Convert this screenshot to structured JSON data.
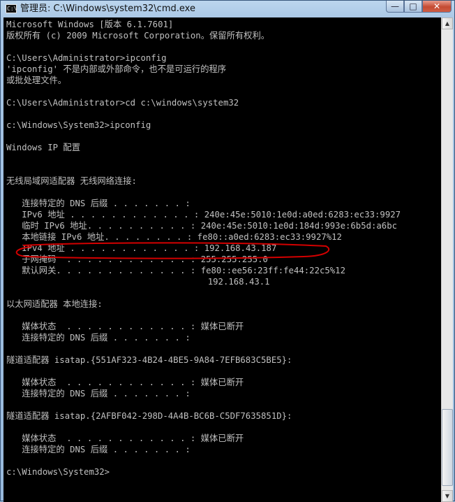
{
  "window": {
    "title": "管理员: C:\\Windows\\system32\\cmd.exe",
    "icon_label": "C:\\",
    "buttons": {
      "minimize": "—",
      "maximize": "□",
      "close": "✕"
    }
  },
  "console": {
    "lines": [
      "Microsoft Windows [版本 6.1.7601]",
      "版权所有 (c) 2009 Microsoft Corporation。保留所有权利。",
      "",
      "C:\\Users\\Administrator>ipconfig",
      "'ipconfig' 不是内部或外部命令，也不是可运行的程序",
      "或批处理文件。",
      "",
      "C:\\Users\\Administrator>cd c:\\windows\\system32",
      "",
      "c:\\Windows\\System32>ipconfig",
      "",
      "Windows IP 配置",
      "",
      "",
      "无线局域网适配器 无线网络连接:",
      "",
      "   连接特定的 DNS 后缀 . . . . . . . :",
      "   IPv6 地址 . . . . . . . . . . . . : 240e:45e:5010:1e0d:a0ed:6283:ec33:9927",
      "   临时 IPv6 地址. . . . . . . . . . : 240e:45e:5010:1e0d:184d:993e:6b5d:a6bc",
      "   本地链接 IPv6 地址. . . . . . . . : fe80::a0ed:6283:ec33:9927%12",
      "   IPv4 地址 . . . . . . . . . . . . : 192.168.43.187",
      "   子网掩码  . . . . . . . . . . . . : 255.255.255.0",
      "   默认网关. . . . . . . . . . . . . : fe80::ee56:23ff:fe44:22c5%12",
      "                                       192.168.43.1",
      "",
      "以太网适配器 本地连接:",
      "",
      "   媒体状态  . . . . . . . . . . . . : 媒体已断开",
      "   连接特定的 DNS 后缀 . . . . . . . :",
      "",
      "隧道适配器 isatap.{551AF323-4B24-4BE5-9A84-7EFB683C5BE5}:",
      "",
      "   媒体状态  . . . . . . . . . . . . : 媒体已断开",
      "   连接特定的 DNS 后缀 . . . . . . . :",
      "",
      "隧道适配器 isatap.{2AFBF042-298D-4A4B-BC6B-C5DF7635851D}:",
      "",
      "   媒体状态  . . . . . . . . . . . . : 媒体已断开",
      "   连接特定的 DNS 后缀 . . . . . . . :",
      "",
      "c:\\Windows\\System32>",
      ""
    ]
  },
  "colors": {
    "console_background": "#000000",
    "console_text": "#c0c0c0",
    "annotation_stroke": "#d30000",
    "close_button": "#c44b33"
  },
  "icons": [
    "console-app-icon",
    "minimize-icon",
    "maximize-icon",
    "close-icon",
    "scroll-up-arrow-icon",
    "scroll-down-arrow-icon"
  ]
}
